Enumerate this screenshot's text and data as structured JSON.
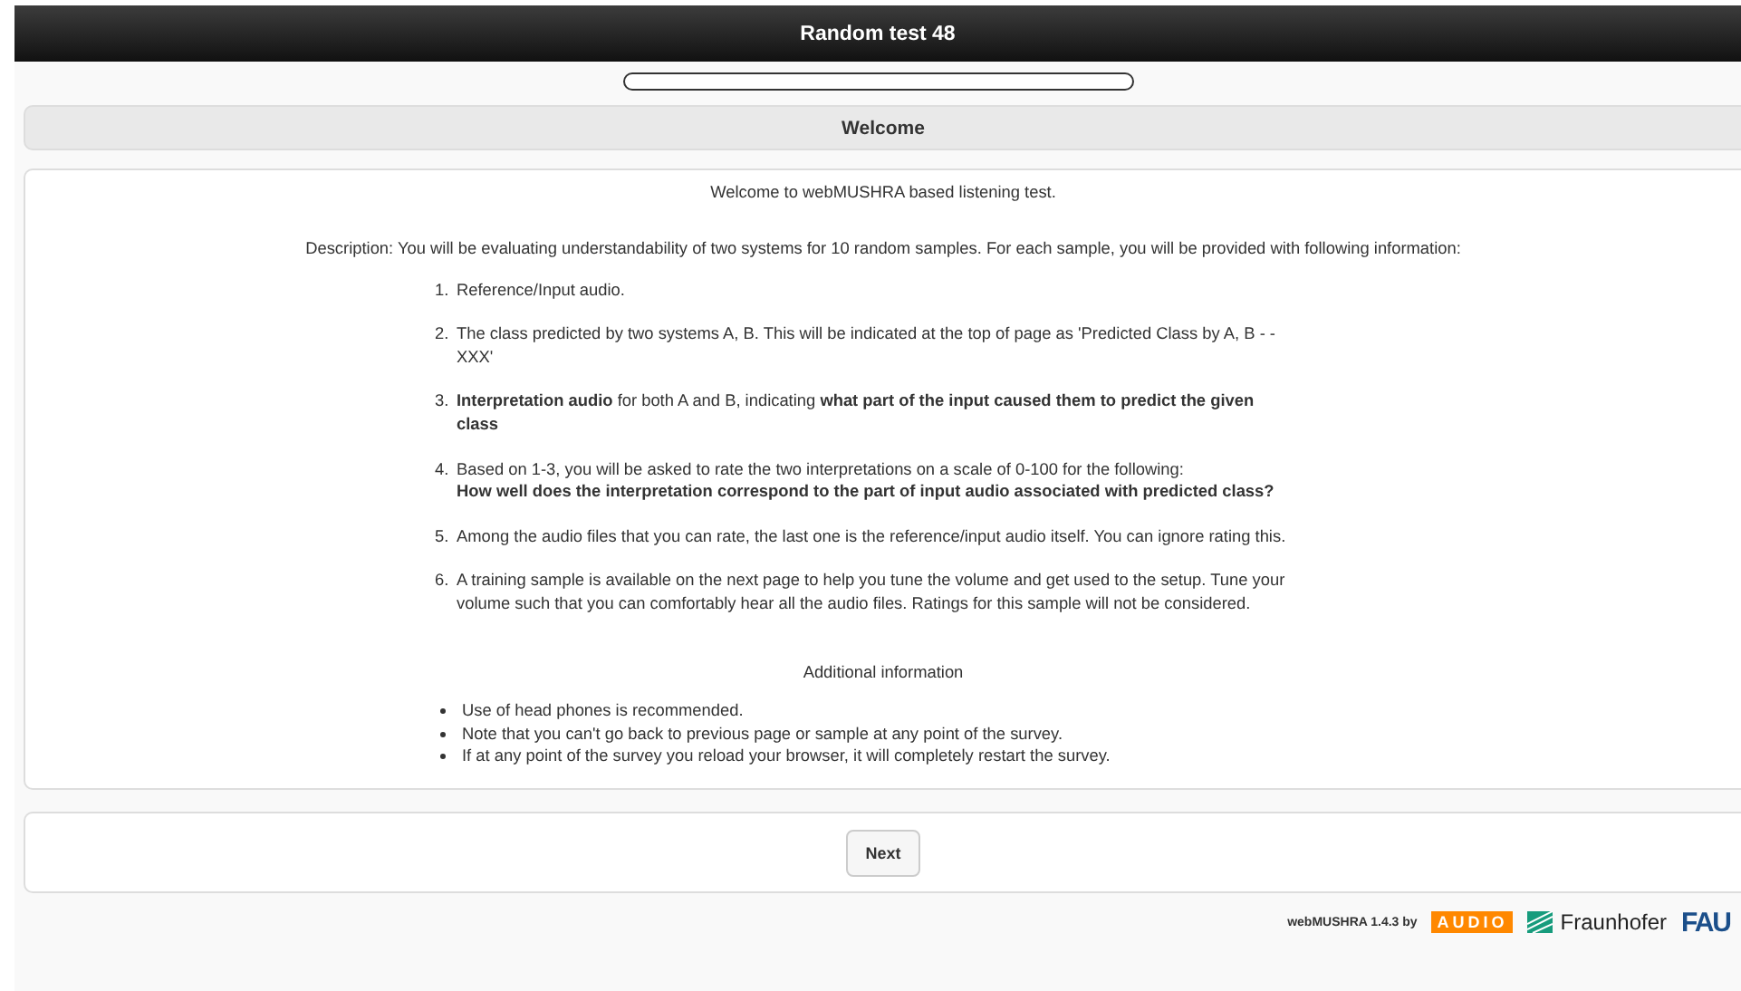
{
  "header": {
    "title": "Random test 48"
  },
  "progress": {
    "level": 0
  },
  "page_title": "Welcome",
  "intro": "Welcome to webMUSHRA based listening test.",
  "description": "Description: You will be evaluating understandability of two systems for 10 random samples. For each sample, you will be provided with following information:",
  "steps": [
    {
      "number": "1.",
      "text": "Reference/Input audio."
    },
    {
      "number": "2.",
      "text": "The class predicted by two systems A, B. This will be indicated at the top of page as 'Predicted Class by A, B - - XXX'"
    },
    {
      "number": "3.",
      "text": "**Interpretation audio** for both A and B, indicating **what part of the input caused them to predict the given class**"
    },
    {
      "number": "4.",
      "text": "Based on 1-3, you will be asked to rate the two interpretations on a scale of 0-100 for the following:",
      "emphasis": "How well does the interpretation correspond to the part of input audio associated with predicted class?"
    },
    {
      "number": "5.",
      "text": "Among the audio files that you can rate, the last one is the reference/input audio itself. You can ignore rating this."
    },
    {
      "number": "6.",
      "text": "A training sample is available on the next page to help you tune the volume and get used to the setup. Tune your volume such that you can comfortably hear all the audio files. Ratings for this sample will not be considered."
    }
  ],
  "additional": {
    "title": "Additional information",
    "items": [
      "Use of head phones is recommended.",
      "Note that you can't go back to previous page or sample at any point of the survey.",
      "If at any point of the survey you reload your browser, it will completely restart the survey."
    ]
  },
  "next_button": "Next",
  "footer": {
    "credit": "webMUSHRA 1.4.3 by",
    "logos": [
      "AUDIO",
      "Fraunhofer",
      "FAU"
    ]
  }
}
